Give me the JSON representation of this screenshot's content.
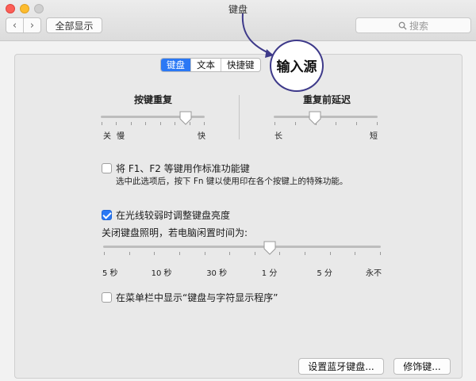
{
  "window": {
    "title": "键盘"
  },
  "toolbar": {
    "back": "‹",
    "forward": "›",
    "show_all": "全部显示",
    "search_placeholder": "搜索"
  },
  "tabs": [
    {
      "label": "键盘",
      "active": true
    },
    {
      "label": "文本",
      "active": false
    },
    {
      "label": "快捷键",
      "active": false
    },
    {
      "label": "输入源",
      "active": false,
      "highlighted": true
    }
  ],
  "key_repeat": {
    "title": "按键重复",
    "min_label": "关",
    "slow_label": "慢",
    "max_label": "快",
    "value_fraction": 0.82
  },
  "repeat_delay": {
    "title": "重复前延迟",
    "min_label": "长",
    "max_label": "短",
    "value_fraction": 0.4
  },
  "fn_keys": {
    "checked": false,
    "label": "将 F1、F2 等键用作标准功能键",
    "description": "选中此选项后，按下 Fn 键以使用印在各个按键上的特殊功能。"
  },
  "backlight": {
    "checked": true,
    "label": "在光线较弱时调整键盘亮度"
  },
  "idle": {
    "label": "关闭键盘照明，若电脑闲置时间为:",
    "ticks": [
      "5 秒",
      "10 秒",
      "30 秒",
      "1 分",
      "5 分",
      "永不"
    ],
    "selected": "1 分"
  },
  "menu_bar": {
    "checked": false,
    "label": "在菜单栏中显示“键盘与字符显示程序”"
  },
  "buttons": {
    "bluetooth": "设置蓝牙键盘...",
    "modifier": "修饰键..."
  },
  "colors": {
    "accent": "#2a78f5",
    "annotation": "#3e3a8a"
  }
}
